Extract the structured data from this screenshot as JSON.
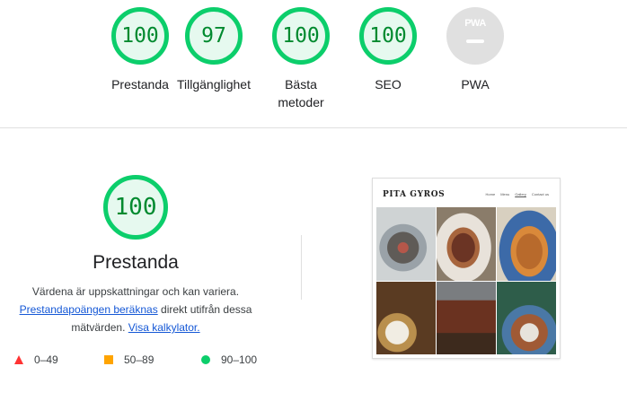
{
  "top_scores": [
    {
      "label": "Prestanda",
      "score": "100"
    },
    {
      "label": "Tillgänglighet",
      "score": "97"
    },
    {
      "label": "Bästa metoder",
      "score": "100"
    },
    {
      "label": "SEO",
      "score": "100"
    },
    {
      "label": "PWA",
      "score": ""
    }
  ],
  "pwa_badge": "PWA",
  "main": {
    "score": "100",
    "title": "Prestanda",
    "desc_text1": "Värdena är uppskattningar och kan variera.",
    "desc_link1": "Prestandapoängen beräknas",
    "desc_text2": " direkt utifrån dessa mätvärden. ",
    "desc_link2": "Visa kalkylator."
  },
  "legend": [
    {
      "range": "0–49",
      "color": "#ff3333",
      "shape": "triangle"
    },
    {
      "range": "50–89",
      "color": "#ffa400",
      "shape": "square"
    },
    {
      "range": "90–100",
      "color": "#0cce6b",
      "shape": "circle"
    }
  ],
  "thumbnail": {
    "site_name": "PITA GYROS",
    "nav": [
      "Home",
      "Menu",
      "Gallery",
      "Contact us"
    ]
  },
  "colors": {
    "pass": "#0cce6b",
    "pass_text": "#008a2f",
    "average": "#ffa400",
    "fail": "#ff3333",
    "link": "#1558d6"
  }
}
